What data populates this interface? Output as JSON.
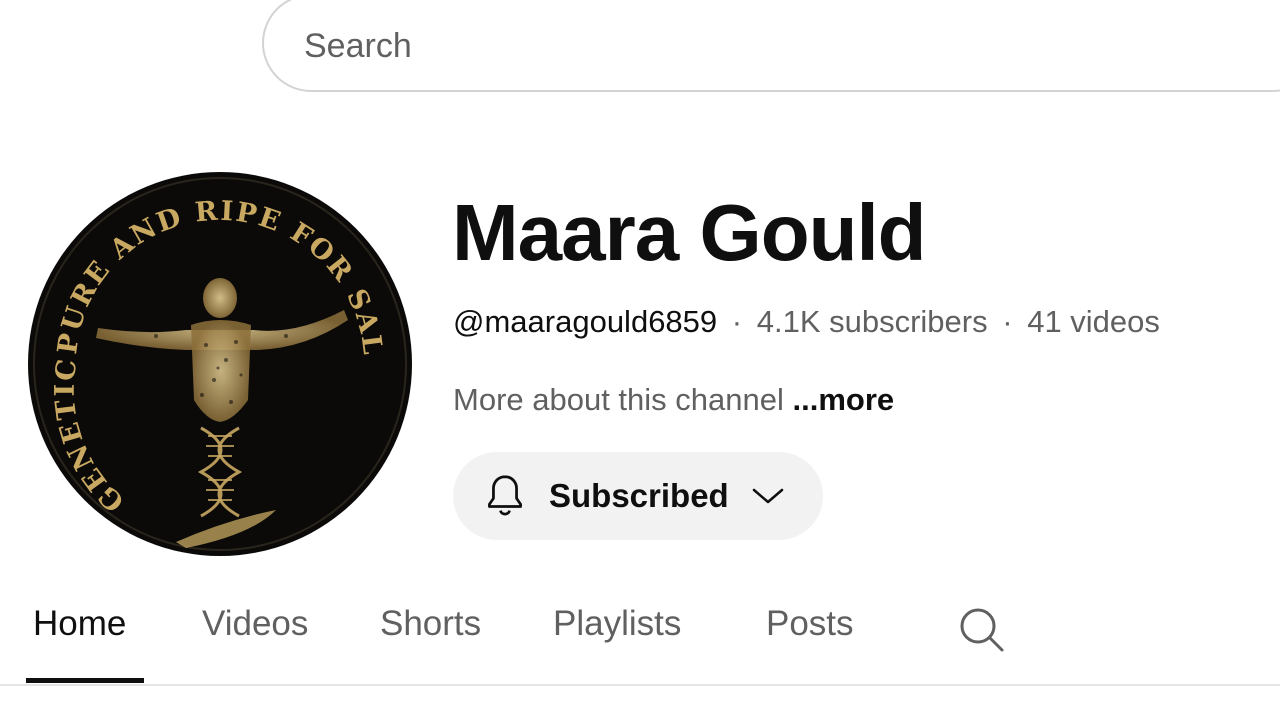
{
  "search": {
    "placeholder": "Search"
  },
  "channel": {
    "name": "Maara Gould",
    "handle": "@maaragould6859",
    "separator": "·",
    "subscribers": "4.1K subscribers",
    "videos": "41 videos",
    "about": "More about this channel",
    "more_label": "...more",
    "avatar": {
      "ring_text_top": "PURE AND RIPE FOR SALVATION",
      "ring_text_bottom": "GENETICALLY",
      "colors": {
        "background": "#0b0a08",
        "gold": "#c9a962"
      }
    }
  },
  "subscribe_button": {
    "label": "Subscribed",
    "icon": "bell-icon",
    "dropdown_icon": "chevron-down-icon"
  },
  "tabs": [
    {
      "label": "Home",
      "active": true
    },
    {
      "label": "Videos",
      "active": false
    },
    {
      "label": "Shorts",
      "active": false
    },
    {
      "label": "Playlists",
      "active": false
    },
    {
      "label": "Posts",
      "active": false
    }
  ],
  "tab_search_icon": "search-icon",
  "colors": {
    "text_primary": "#0f0f0f",
    "text_secondary": "#606060",
    "button_bg": "#f2f2f2",
    "border": "#d3d3d3"
  }
}
